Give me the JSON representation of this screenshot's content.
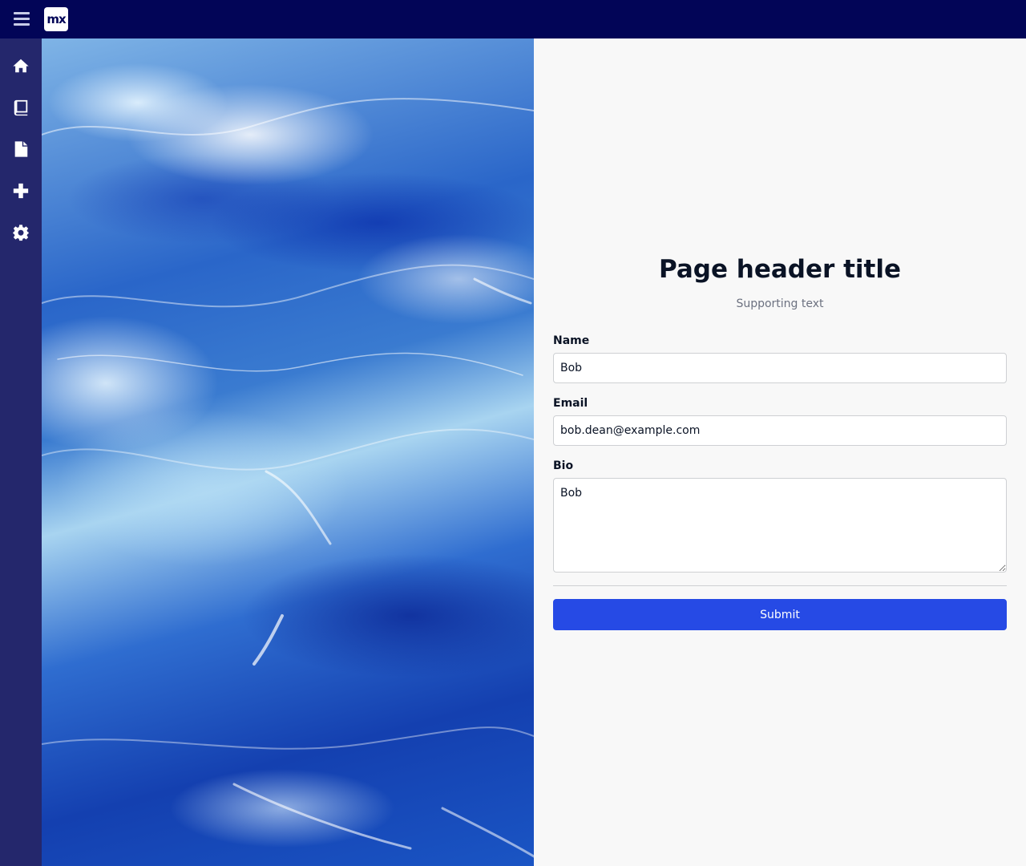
{
  "topbar": {
    "menu_icon": "hamburger-menu-icon",
    "logo_text": "mx"
  },
  "sidebar": {
    "items": [
      {
        "icon": "home-icon"
      },
      {
        "icon": "book-icon"
      },
      {
        "icon": "document-icon"
      },
      {
        "icon": "plus-icon"
      },
      {
        "icon": "gear-icon"
      }
    ]
  },
  "hero": {
    "image": "ocean-waves"
  },
  "main": {
    "title": "Page header title",
    "supporting_text": "Supporting text",
    "form": {
      "name_label": "Name",
      "name_value": "Bob",
      "email_label": "Email",
      "email_value": "bob.dean@example.com",
      "bio_label": "Bio",
      "bio_value": "Bob",
      "submit_label": "Submit"
    }
  },
  "colors": {
    "topbar": "#020557",
    "sidebar": "#24276c",
    "primary": "#264ae5",
    "background": "#f8f8f8"
  }
}
